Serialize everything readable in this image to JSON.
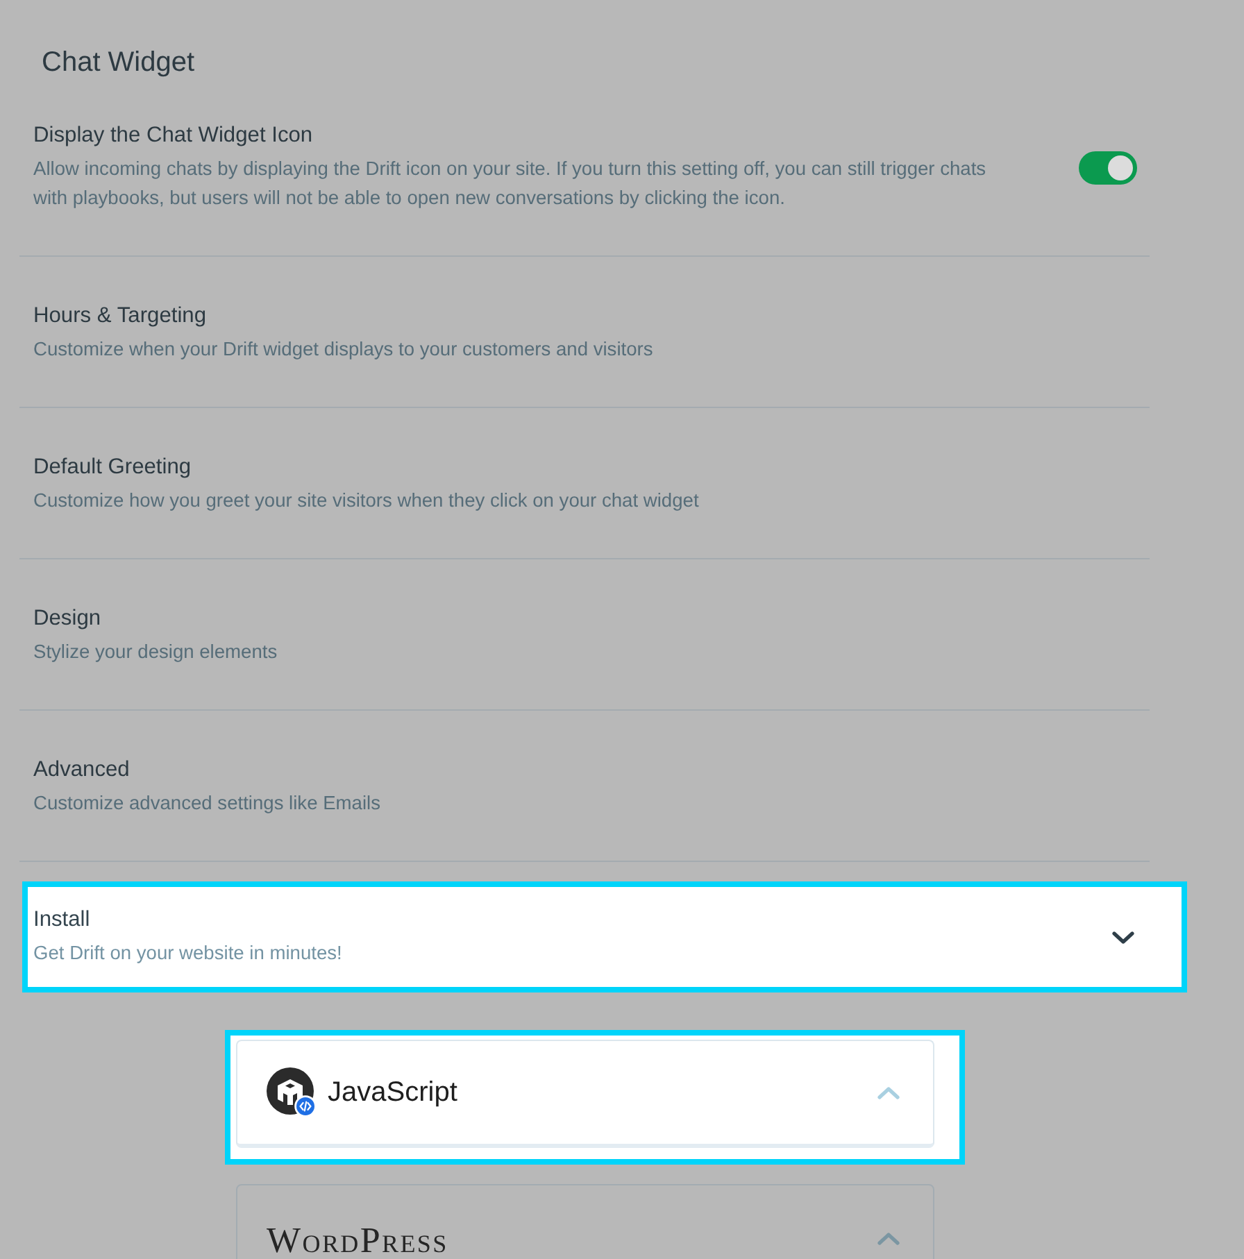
{
  "page_title": "Chat Widget",
  "sections": [
    {
      "kind": "toggle",
      "title": "Display the Chat Widget Icon",
      "description": "Allow incoming chats by displaying the Drift icon on your site. If you turn this setting off, you can still trigger chats with playbooks, but users will not be able to open new conversations by clicking the icon.",
      "on": true,
      "highlighted": false
    },
    {
      "kind": "link",
      "title": "Hours & Targeting",
      "description": "Customize when your Drift widget displays to your customers and visitors",
      "highlighted": false
    },
    {
      "kind": "link",
      "title": "Default Greeting",
      "description": "Customize how you greet your site visitors when they click on your chat widget",
      "highlighted": false
    },
    {
      "kind": "link",
      "title": "Design",
      "description": "Stylize your design elements",
      "highlighted": false
    },
    {
      "kind": "link",
      "title": "Advanced",
      "description": "Customize advanced settings like Emails",
      "highlighted": false
    },
    {
      "kind": "expander",
      "title": "Install",
      "description": "Get Drift on your website in minutes!",
      "expanded": false,
      "highlighted": true
    }
  ],
  "install_options": [
    {
      "kind": "javascript",
      "label": "JavaScript",
      "expanded": true,
      "highlighted": true
    },
    {
      "kind": "wordpress",
      "label": "WordPress",
      "expanded": true,
      "highlighted": false
    }
  ]
}
